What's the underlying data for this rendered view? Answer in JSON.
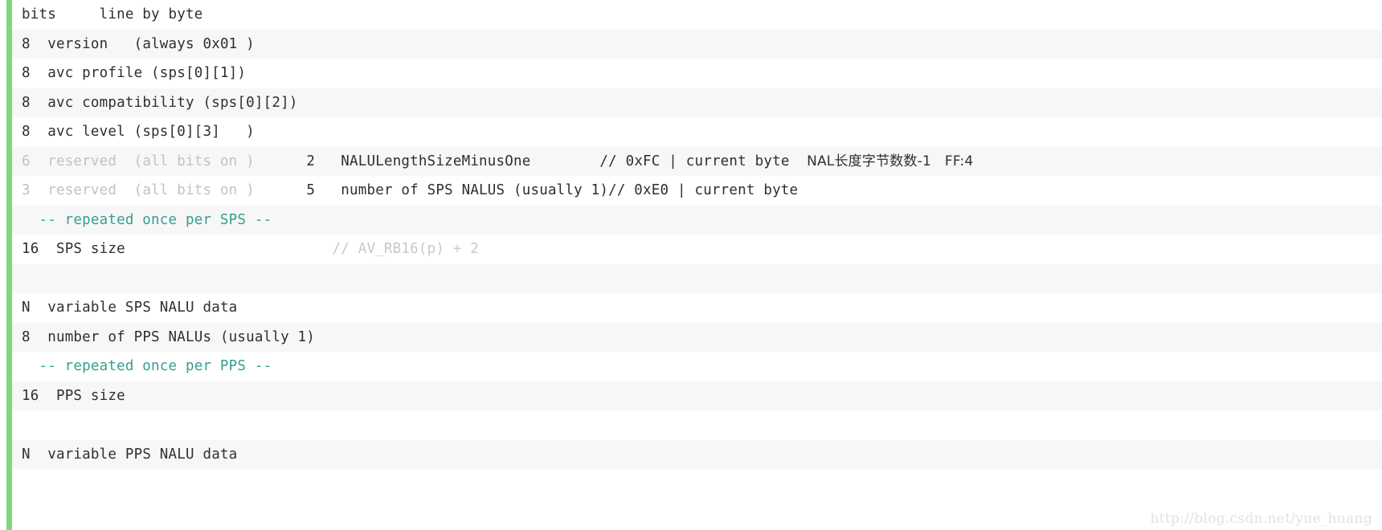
{
  "block": {
    "accent_color": "#7bdb7b",
    "stripe_color": "#f7f7f7",
    "base_color": "#ffffff",
    "text_color": "#2f2f2f",
    "dim_color": "#c2c2c2",
    "teal_color": "#33a08d",
    "comment_color": "#c8c8c8"
  },
  "rows": [
    {
      "bits": "bits",
      "desc": "     line by byte",
      "extra_bits": "",
      "extra_desc": "",
      "comment": "",
      "note": ""
    },
    {
      "bits": "8",
      "desc": "  version   (always 0x01 )",
      "extra_bits": "",
      "extra_desc": "",
      "comment": "",
      "note": ""
    },
    {
      "bits": "8",
      "desc": "  avc profile (sps[0][1])",
      "extra_bits": "",
      "extra_desc": "",
      "comment": "",
      "note": ""
    },
    {
      "bits": "8",
      "desc": "  avc compatibility (sps[0][2])",
      "extra_bits": "",
      "extra_desc": "",
      "comment": "",
      "note": ""
    },
    {
      "bits": "8",
      "desc": "  avc level (sps[0][3]   )",
      "extra_bits": "",
      "extra_desc": "",
      "comment": "",
      "note": ""
    },
    {
      "bits": "6",
      "desc": "  reserved  (all bits on )",
      "extra_bits": "2",
      "extra_desc": "NALULengthSizeMinusOne",
      "comment": "// 0xFC | current byte",
      "note": "NAL长度字节数数-1   FF:4"
    },
    {
      "bits": "3",
      "desc": "  reserved  (all bits on )",
      "extra_bits": "5",
      "extra_desc": "number of SPS NALUS (usually 1)",
      "comment": "// 0xE0 | current byte",
      "note": ""
    },
    {
      "bits": "",
      "desc": "  -- repeated once per SPS --",
      "extra_bits": "",
      "extra_desc": "",
      "comment": "",
      "note": ""
    },
    {
      "bits": "16",
      "desc": "  SPS size",
      "extra_bits": "",
      "extra_desc": "",
      "comment": "// AV_RB16(p) + 2",
      "note": ""
    },
    {
      "bits": "",
      "desc": "",
      "extra_bits": "",
      "extra_desc": "",
      "comment": "",
      "note": ""
    },
    {
      "bits": "N",
      "desc": "  variable SPS NALU data",
      "extra_bits": "",
      "extra_desc": "",
      "comment": "",
      "note": ""
    },
    {
      "bits": "8",
      "desc": "  number of PPS NALUs (usually 1)",
      "extra_bits": "",
      "extra_desc": "",
      "comment": "",
      "note": ""
    },
    {
      "bits": "",
      "desc": "  -- repeated once per PPS --",
      "extra_bits": "",
      "extra_desc": "",
      "comment": "",
      "note": ""
    },
    {
      "bits": "16",
      "desc": "  PPS size",
      "extra_bits": "",
      "extra_desc": "",
      "comment": "",
      "note": ""
    },
    {
      "bits": "",
      "desc": "",
      "extra_bits": "",
      "extra_desc": "",
      "comment": "",
      "note": ""
    },
    {
      "bits": "N",
      "desc": "  variable PPS NALU data",
      "extra_bits": "",
      "extra_desc": "",
      "comment": "",
      "note": ""
    }
  ],
  "row_styles": [
    {
      "stripe": false,
      "dim": false,
      "teal": false
    },
    {
      "stripe": true,
      "dim": false,
      "teal": false
    },
    {
      "stripe": false,
      "dim": false,
      "teal": false
    },
    {
      "stripe": true,
      "dim": false,
      "teal": false
    },
    {
      "stripe": false,
      "dim": false,
      "teal": false
    },
    {
      "stripe": true,
      "dim": true,
      "teal": false
    },
    {
      "stripe": false,
      "dim": true,
      "teal": false
    },
    {
      "stripe": true,
      "dim": false,
      "teal": true
    },
    {
      "stripe": false,
      "dim": false,
      "teal": false
    },
    {
      "stripe": true,
      "dim": false,
      "teal": false
    },
    {
      "stripe": false,
      "dim": false,
      "teal": false
    },
    {
      "stripe": true,
      "dim": false,
      "teal": false
    },
    {
      "stripe": false,
      "dim": false,
      "teal": true
    },
    {
      "stripe": true,
      "dim": false,
      "teal": false
    },
    {
      "stripe": false,
      "dim": false,
      "teal": false
    },
    {
      "stripe": true,
      "dim": false,
      "teal": false
    }
  ],
  "watermark": {
    "text": "http://blog.csdn.net/yue_huang"
  }
}
